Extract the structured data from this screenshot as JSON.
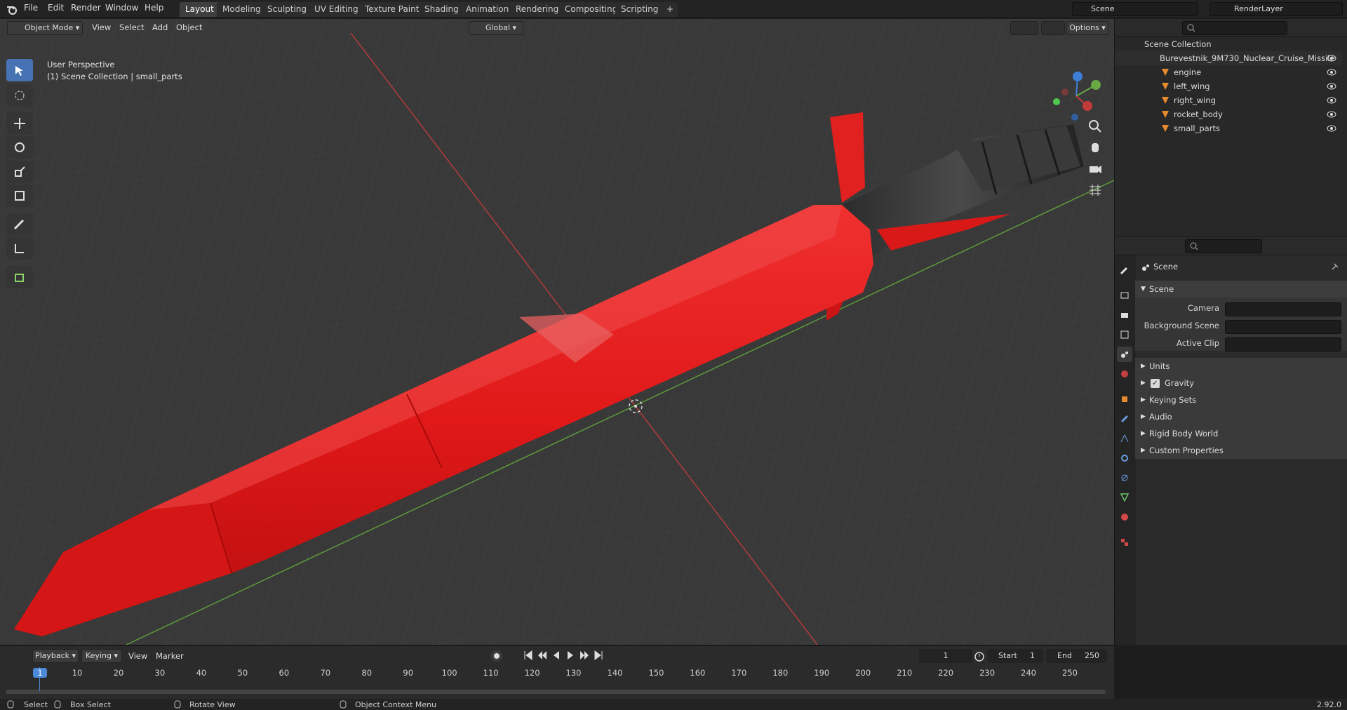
{
  "menu": {
    "file": "File",
    "edit": "Edit",
    "render": "Render",
    "window": "Window",
    "help": "Help"
  },
  "workspaces": [
    "Layout",
    "Modeling",
    "Sculpting",
    "UV Editing",
    "Texture Paint",
    "Shading",
    "Animation",
    "Rendering",
    "Compositing",
    "Scripting"
  ],
  "scene_name": "Scene",
  "view_layer": "RenderLayer",
  "viewport": {
    "mode": "Object Mode",
    "menus": [
      "View",
      "Select",
      "Add",
      "Object"
    ],
    "transform_orientation": "Global",
    "options": "Options",
    "overlay_line1": "User Perspective",
    "overlay_line2": "(1) Scene Collection | small_parts"
  },
  "outliner": {
    "root": "Scene Collection",
    "collection": "Burevestnik_9M730_Nuclear_Cruise_Missile",
    "objects": [
      "engine",
      "left_wing",
      "right_wing",
      "rocket_body",
      "small_parts"
    ]
  },
  "properties": {
    "context": "Scene",
    "panel": "Scene",
    "camera_label": "Camera",
    "background_scene_label": "Background Scene",
    "active_clip_label": "Active Clip",
    "subpanels": [
      "Units",
      "Gravity",
      "Keying Sets",
      "Audio",
      "Rigid Body World",
      "Custom Properties"
    ],
    "gravity_checked": true
  },
  "timeline": {
    "menus": [
      "Playback",
      "Keying",
      "View",
      "Marker"
    ],
    "current_frame": "1",
    "start_label": "Start",
    "start": "1",
    "end_label": "End",
    "end": "250",
    "ticks": [
      "1",
      "10",
      "20",
      "30",
      "40",
      "50",
      "60",
      "70",
      "80",
      "90",
      "100",
      "110",
      "120",
      "130",
      "140",
      "150",
      "160",
      "170",
      "180",
      "190",
      "200",
      "210",
      "220",
      "230",
      "240",
      "250"
    ]
  },
  "status": {
    "select": "Select",
    "box_select": "Box Select",
    "rotate_view": "Rotate View",
    "context_menu": "Object Context Menu",
    "version": "2.92.0"
  },
  "colors": {
    "accent": "#4772b3",
    "missile": "#e21a1a",
    "axis_x": "#c43a3a",
    "axis_y": "#6aa845",
    "axis_z": "#3d7fd6"
  }
}
